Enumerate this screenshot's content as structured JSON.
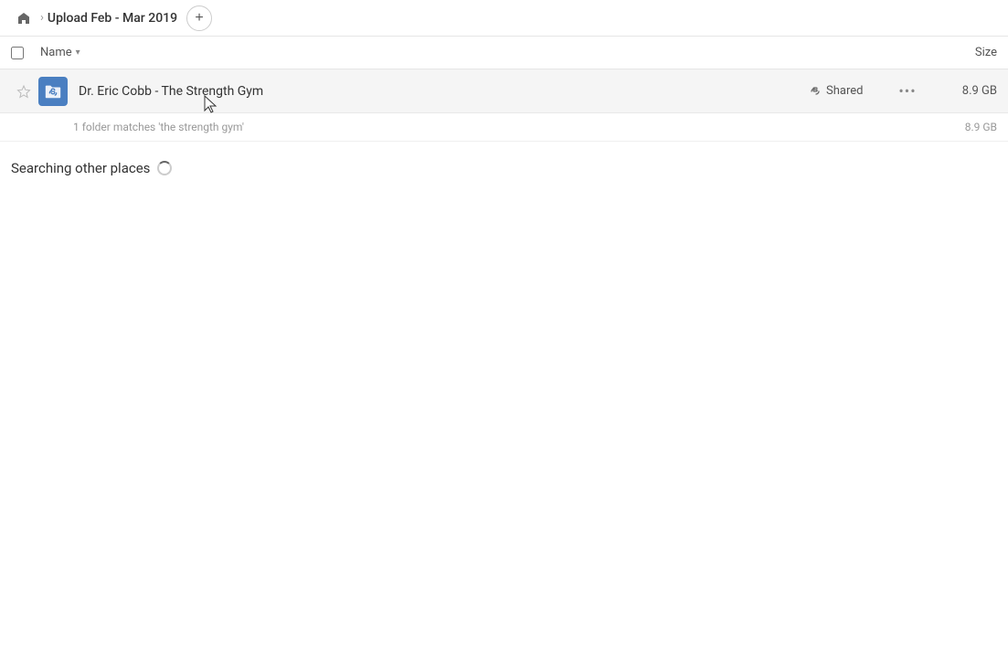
{
  "breadcrumb": {
    "home_icon": "home",
    "separator": "›",
    "title": "Upload Feb - Mar 2019",
    "add_button_label": "+"
  },
  "columns": {
    "name_label": "Name",
    "sort_icon": "▾",
    "size_label": "Size"
  },
  "file_row": {
    "name": "Dr. Eric Cobb - The Strength Gym",
    "shared_label": "Shared",
    "size": "8.9 GB",
    "more_icon": "···"
  },
  "match_info": {
    "text": "1 folder matches 'the strength gym'",
    "size": "8.9 GB"
  },
  "searching": {
    "label": "Searching other places"
  }
}
